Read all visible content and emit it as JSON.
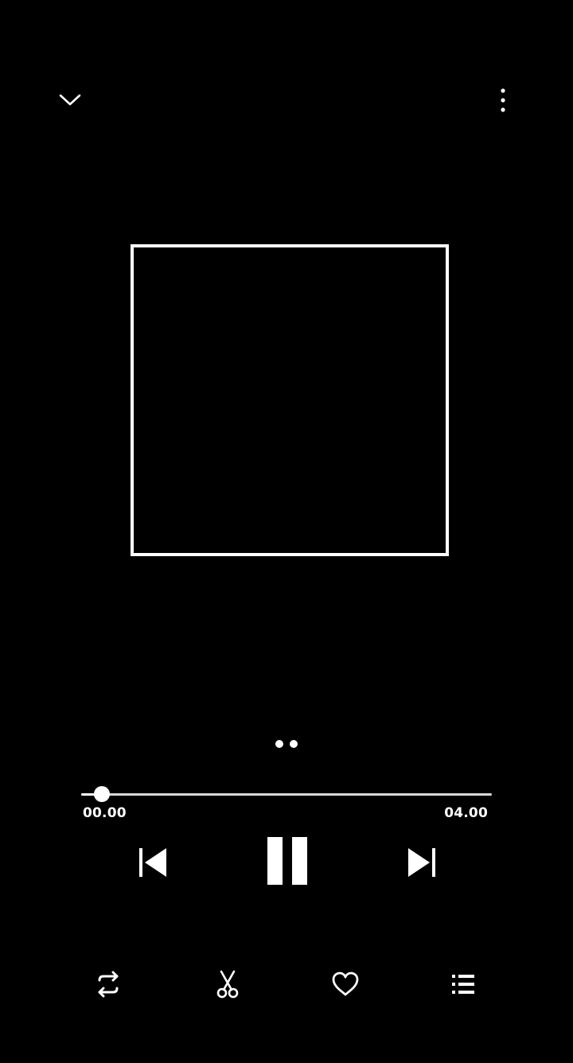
{
  "player": {
    "elapsed": "00.00",
    "duration": "04.00",
    "progress_fraction": 0.05,
    "page_dots": 2,
    "is_playing": true
  },
  "colors": {
    "background": "#000000",
    "foreground": "#ffffff"
  },
  "icons": {
    "collapse": "chevron-down-icon",
    "more": "more-vertical-icon",
    "previous": "skip-previous-icon",
    "pause": "pause-icon",
    "next": "skip-next-icon",
    "repeat": "repeat-icon",
    "cut": "scissors-icon",
    "favorite": "heart-icon",
    "queue": "list-icon"
  }
}
